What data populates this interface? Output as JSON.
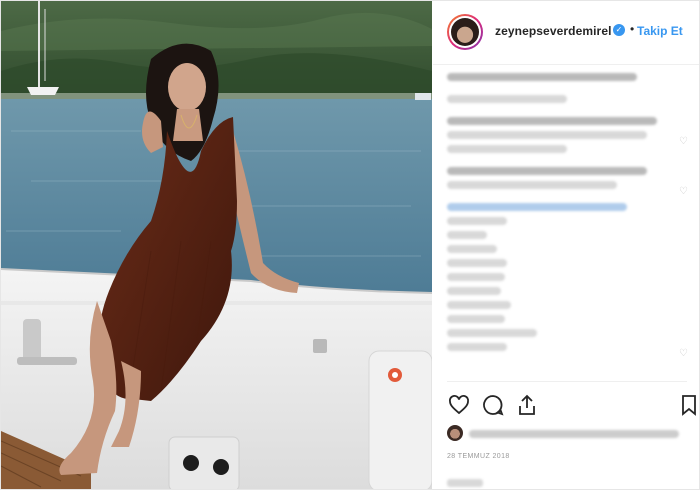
{
  "header": {
    "username": "zeynepseverdemirel",
    "separator": "•",
    "follow_label": "Takip Et"
  },
  "icons": {
    "verified": "verified-badge-icon",
    "like": "heart-icon",
    "comment": "comment-bubble-icon",
    "share": "share-icon",
    "save": "bookmark-icon"
  },
  "post": {
    "date": "28 TEMMUZ 2018"
  },
  "colors": {
    "accent": "#3897f0",
    "text": "#262626",
    "muted": "#999999",
    "sea": "#5d8aa0",
    "dress": "#5a2616"
  }
}
